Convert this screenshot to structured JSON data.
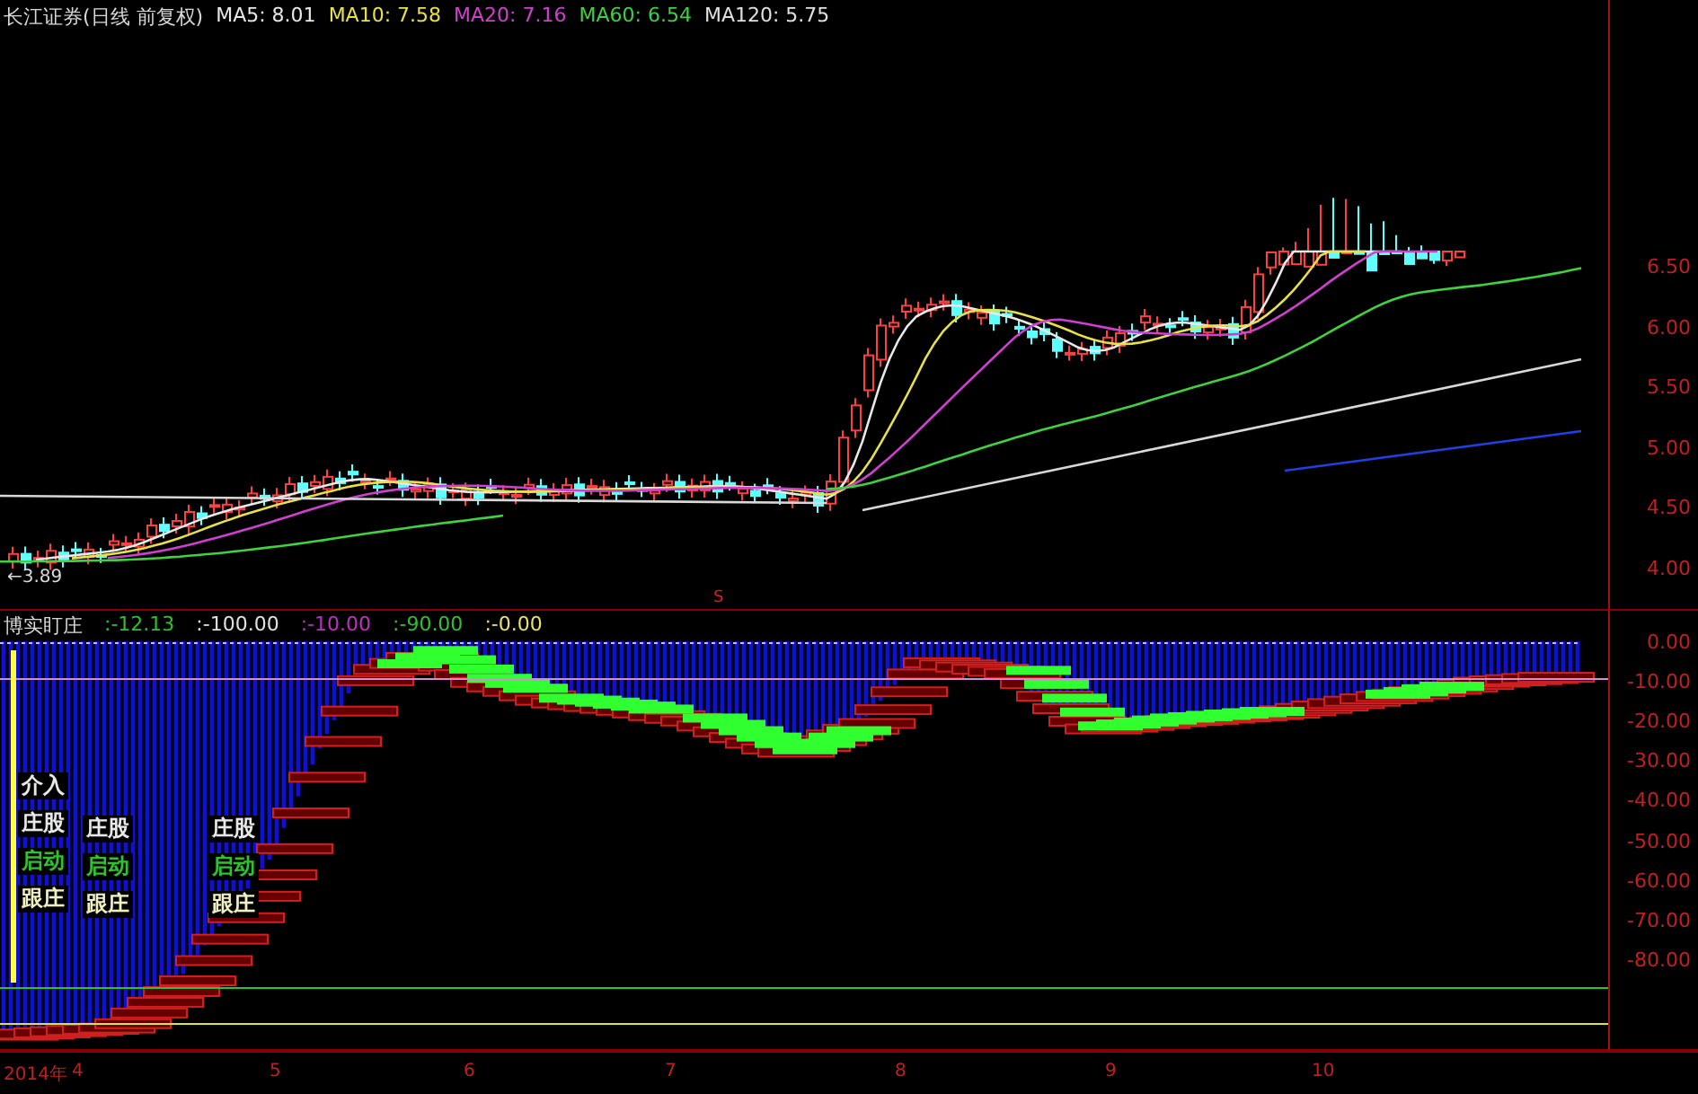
{
  "header": {
    "title": "长江证券(日线 前复权)",
    "indicators": [
      {
        "name": "MA5:",
        "value": "8.01",
        "color": "#e8e8e8"
      },
      {
        "name": "MA10:",
        "value": "7.58",
        "color": "#e8e04a"
      },
      {
        "name": "MA20:",
        "value": "7.16",
        "color": "#d040d0"
      },
      {
        "name": "MA60:",
        "value": "6.54",
        "color": "#40d040"
      },
      {
        "name": "MA120:",
        "value": "5.75",
        "color": "#e0e0e0"
      }
    ]
  },
  "price_axis": [
    "6.50",
    "6.00",
    "5.50",
    "5.00",
    "4.50",
    "4.00"
  ],
  "low_marker": "←3.89",
  "signal_mark": "S",
  "indicator_panel": {
    "name": "博实盯庄",
    "values": [
      {
        "text": ":-12.13",
        "color": "#30c030"
      },
      {
        "text": ":-100.00",
        "color": "#e0e0e0"
      },
      {
        "text": ":-10.00",
        "color": "#c030c0"
      },
      {
        "text": ":-90.00",
        "color": "#30c030"
      },
      {
        "text": ":-0.00",
        "color": "#e8e070"
      }
    ],
    "signal_columns": [
      {
        "items": [
          {
            "text": "介入",
            "kind": "entry"
          },
          {
            "text": "庄股",
            "kind": "stock"
          },
          {
            "text": "启动",
            "kind": "start"
          },
          {
            "text": "跟庄",
            "kind": "follow"
          }
        ]
      },
      {
        "items": [
          {
            "text": "庄股",
            "kind": "stock"
          },
          {
            "text": "启动",
            "kind": "start"
          },
          {
            "text": "跟庄",
            "kind": "follow"
          }
        ]
      },
      {
        "items": [
          {
            "text": "庄股",
            "kind": "stock"
          },
          {
            "text": "启动",
            "kind": "start"
          },
          {
            "text": "跟庄",
            "kind": "follow"
          }
        ]
      }
    ]
  },
  "indicator_axis": [
    "0.00",
    "-10.00",
    "-20.00",
    "-30.00",
    "-40.00",
    "-50.00",
    "-60.00",
    "-70.00",
    "-80.00"
  ],
  "time_axis": [
    "2014年",
    "4",
    "5",
    "6",
    "7",
    "8",
    "9",
    "10"
  ]
}
